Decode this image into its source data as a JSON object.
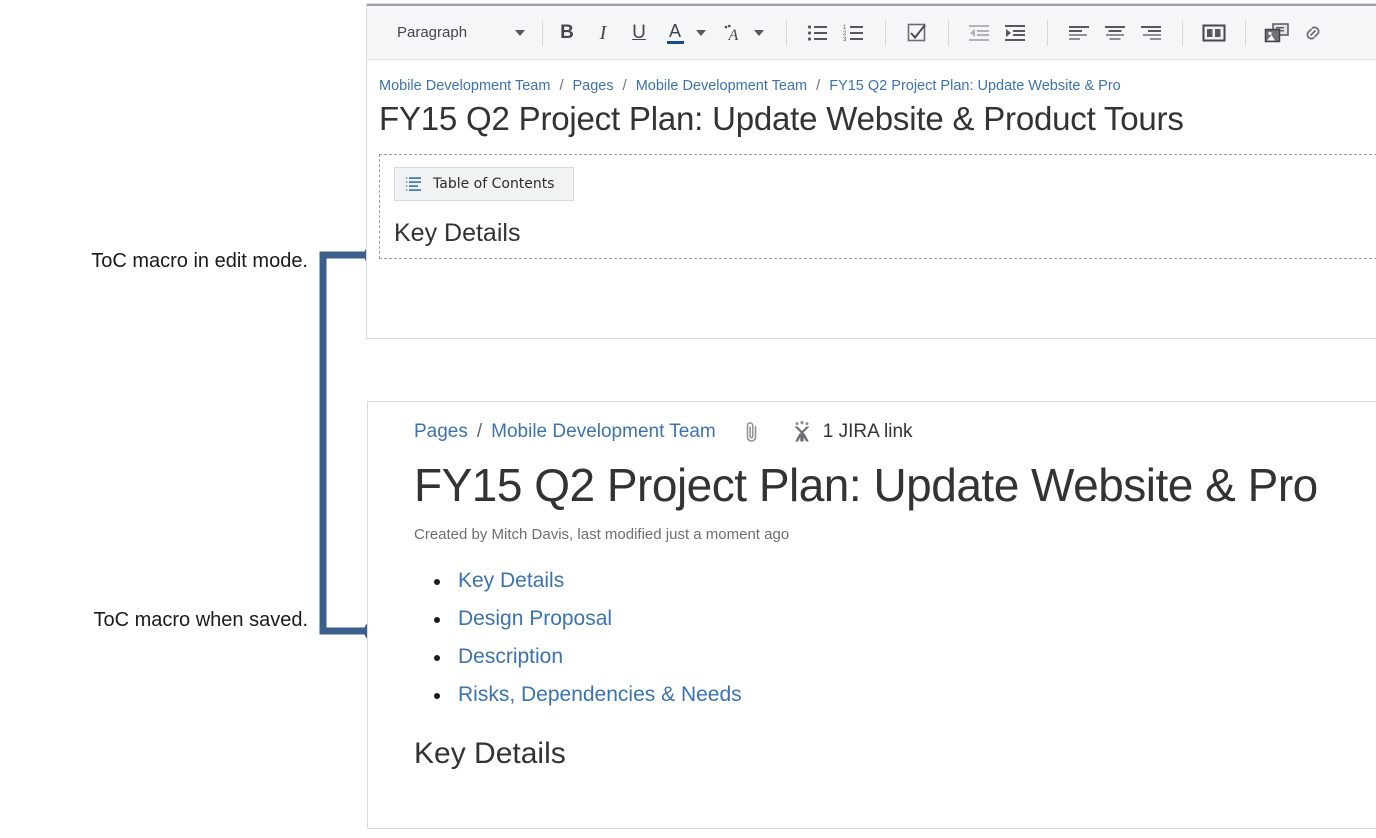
{
  "annotations": {
    "edit_mode_label": "ToC macro in edit mode.",
    "saved_label": "ToC macro when saved.",
    "connector_color": "#3a5f8a"
  },
  "editor": {
    "toolbar": {
      "style_select_value": "Paragraph",
      "buttons": [
        {
          "name": "bold",
          "label": "B"
        },
        {
          "name": "italic",
          "label": "I"
        },
        {
          "name": "underline",
          "label": "U"
        },
        {
          "name": "text-color",
          "label": "A"
        },
        {
          "name": "text-color-dropdown",
          "label": ""
        },
        {
          "name": "more-formatting",
          "label": "A"
        },
        {
          "name": "more-formatting-dropdown",
          "label": ""
        },
        {
          "name": "bullet-list",
          "label": ""
        },
        {
          "name": "numbered-list",
          "label": ""
        },
        {
          "name": "task-list",
          "label": ""
        },
        {
          "name": "outdent",
          "label": ""
        },
        {
          "name": "indent",
          "label": ""
        },
        {
          "name": "align-left",
          "label": ""
        },
        {
          "name": "align-center",
          "label": ""
        },
        {
          "name": "align-right",
          "label": ""
        },
        {
          "name": "page-layout",
          "label": ""
        },
        {
          "name": "insert-image",
          "label": ""
        },
        {
          "name": "insert-link",
          "label": ""
        }
      ]
    },
    "breadcrumb": [
      "Mobile Development Team",
      "Pages",
      "Mobile Development Team",
      "FY15 Q2 Project Plan: Update Website & Pro"
    ],
    "title": "FY15 Q2 Project Plan: Update Website & Product Tours",
    "toc_macro_label": "Table of Contents",
    "heading": "Key Details"
  },
  "saved": {
    "breadcrumb": [
      "Pages",
      "Mobile Development Team"
    ],
    "attachment_icon": "paperclip-icon",
    "jira_icon": "jira-icon",
    "jira_link_text": "1 JIRA link",
    "title": "FY15 Q2 Project Plan: Update Website & Pro",
    "byline": "Created by Mitch Davis, last modified just a moment ago",
    "toc_items": [
      "Key Details",
      "Design Proposal",
      "Description",
      "Risks, Dependencies & Needs"
    ],
    "heading": "Key Details"
  },
  "colors": {
    "link": "#3b73af",
    "text": "#333333",
    "muted": "#6b6f74",
    "toolbar_bg": "#f5f6f7",
    "panel_border": "#d9dbe0"
  }
}
